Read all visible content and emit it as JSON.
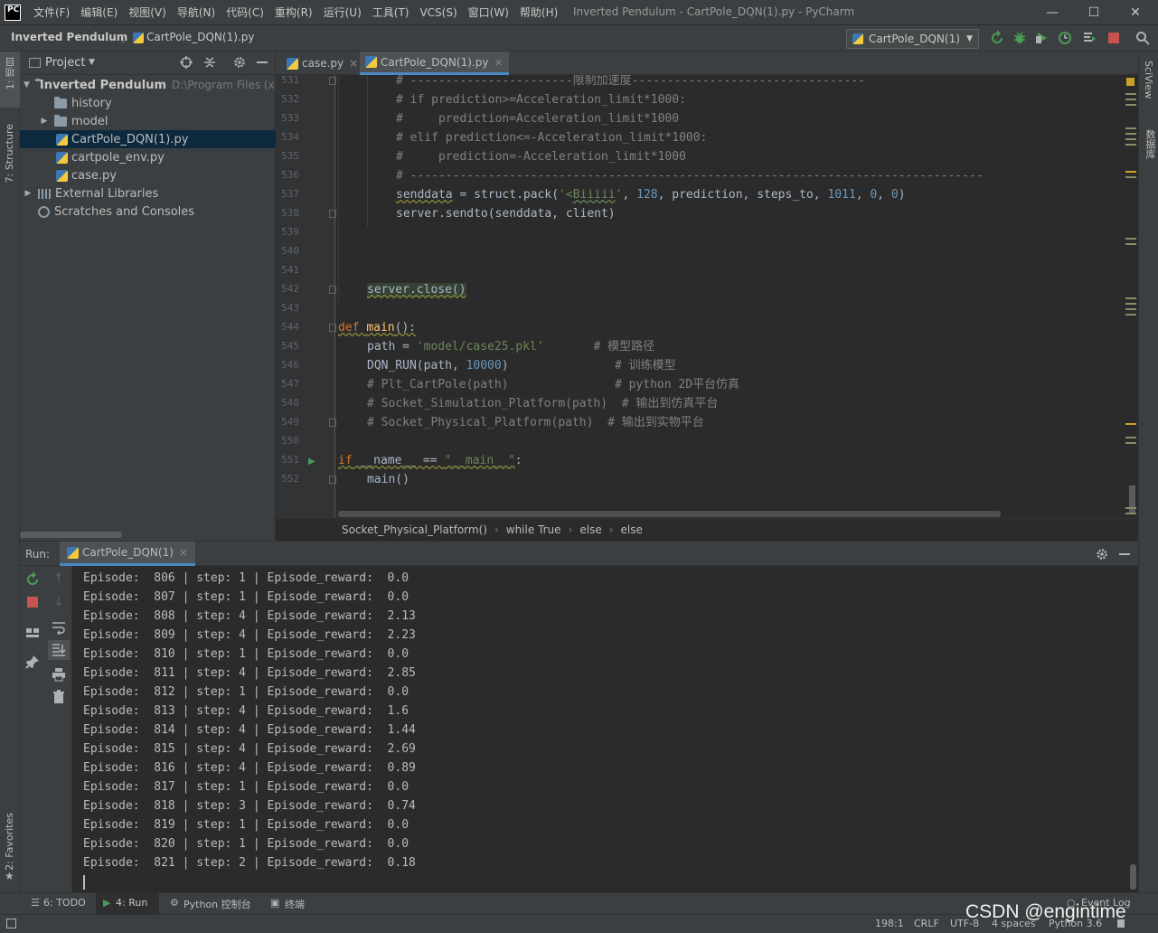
{
  "app": {
    "logo": "PC",
    "title": "Inverted Pendulum - CartPole_DQN(1).py - PyCharm"
  },
  "menu": [
    "文件(F)",
    "编辑(E)",
    "视图(V)",
    "导航(N)",
    "代码(C)",
    "重构(R)",
    "运行(U)",
    "工具(T)",
    "VCS(S)",
    "窗口(W)",
    "帮助(H)"
  ],
  "window_controls": {
    "minimize": "—",
    "maximize": "☐",
    "close": "✕"
  },
  "navbar": {
    "project": "Inverted Pendulum",
    "file": "CartPole_DQN(1).py",
    "run_config": "CartPole_DQN(1)"
  },
  "left_strip": {
    "project_tab": "1: 项目",
    "structure_tab": "7: Structure",
    "favorites_tab": "2: Favorites"
  },
  "right_strip": {
    "sciview_tab": "SciView",
    "database_tab": "数据库"
  },
  "project_panel": {
    "title": "Project",
    "tree": [
      {
        "label": "Inverted Pendulum",
        "hint": "D:\\Program Files (x8",
        "type": "folder",
        "arrow": "▼"
      },
      {
        "label": "history",
        "type": "folder",
        "arrow": ""
      },
      {
        "label": "model",
        "type": "folder",
        "arrow": "▶"
      },
      {
        "label": "CartPole_DQN(1).py",
        "type": "py",
        "arrow": ""
      },
      {
        "label": "cartpole_env.py",
        "type": "py",
        "arrow": ""
      },
      {
        "label": "case.py",
        "type": "py",
        "arrow": ""
      },
      {
        "label": "External Libraries",
        "type": "lib",
        "arrow": "▶"
      },
      {
        "label": "Scratches and Consoles",
        "type": "scratch",
        "arrow": ""
      }
    ]
  },
  "editor": {
    "tabs": [
      {
        "label": "case.py",
        "close": "×"
      },
      {
        "label": "CartPole_DQN(1).py",
        "close": "×"
      }
    ],
    "line_numbers": [
      "531",
      "532",
      "533",
      "534",
      "535",
      "536",
      "537",
      "538",
      "539",
      "540",
      "541",
      "542",
      "543",
      "544",
      "545",
      "546",
      "547",
      "548",
      "549",
      "550",
      "551",
      "552"
    ],
    "code": {
      "l531": "# -----------------------限制加速度---------------------------------",
      "l532": "# if prediction>=Acceleration_limit*1000:",
      "l533": "#     prediction=Acceleration_limit*1000",
      "l534": "# elif prediction<=-Acceleration_limit*1000:",
      "l535": "#     prediction=-Acceleration_limit*1000",
      "l536": "# ---------------------------------------------------------------------------------",
      "l537": {
        "a": "senddata",
        "b": " = struct.pack(",
        "c": "'<",
        "d": "Biiiii",
        "e": "'",
        "f": ", ",
        "g": "128",
        "h": ", prediction, steps_to, ",
        "i": "1011",
        "j": ", ",
        "k": "0",
        "l": ", ",
        "m": "0",
        "n": ")"
      },
      "l538": "server.sendto(senddata, client)",
      "l542": "server.close()",
      "l544": {
        "kw": "def ",
        "fn": "main",
        "rest": "():"
      },
      "l545": {
        "a": "path = ",
        "s": "'model/case25.pkl'",
        "c": "       # 模型路径"
      },
      "l546": {
        "a": "DQN_RUN(path, ",
        "n": "10000",
        "b": ")",
        "c": "               # 训练模型"
      },
      "l547": {
        "a": "# Plt_CartPole(path)",
        "c": "               # python 2D平台仿真"
      },
      "l548": "# Socket_Simulation_Platform(path)  # 输出到仿真平台",
      "l549": "# Socket_Physical_Platform(path)  # 输出到实物平台",
      "l551": {
        "kw": "if",
        "a": " __name__ == ",
        "s": "\"__main__\"",
        "b": ":"
      },
      "l552": "main()"
    },
    "breadcrumb": [
      "Socket_Physical_Platform()",
      "while True",
      "else",
      "else"
    ]
  },
  "run_panel": {
    "label": "Run:",
    "tab": "CartPole_DQN(1)",
    "close": "×",
    "console": [
      "Episode:  806 | step: 1 | Episode_reward:  0.0",
      "Episode:  807 | step: 1 | Episode_reward:  0.0",
      "Episode:  808 | step: 4 | Episode_reward:  2.13",
      "Episode:  809 | step: 4 | Episode_reward:  2.23",
      "Episode:  810 | step: 1 | Episode_reward:  0.0",
      "Episode:  811 | step: 4 | Episode_reward:  2.85",
      "Episode:  812 | step: 1 | Episode_reward:  0.0",
      "Episode:  813 | step: 4 | Episode_reward:  1.6",
      "Episode:  814 | step: 4 | Episode_reward:  1.44",
      "Episode:  815 | step: 4 | Episode_reward:  2.69",
      "Episode:  816 | step: 4 | Episode_reward:  0.89",
      "Episode:  817 | step: 1 | Episode_reward:  0.0",
      "Episode:  818 | step: 3 | Episode_reward:  0.74",
      "Episode:  819 | step: 1 | Episode_reward:  0.0",
      "Episode:  820 | step: 1 | Episode_reward:  0.0",
      "Episode:  821 | step: 2 | Episode_reward:  0.18"
    ]
  },
  "bottom_tools": {
    "todo": "6: TODO",
    "run": "4: Run",
    "python_console": "Python 控制台",
    "terminal": "终端",
    "event_log": "Event Log"
  },
  "status": {
    "position": "198:1",
    "line_sep": "CRLF",
    "encoding": "UTF-8",
    "indent": "4 spaces",
    "interpreter": "Python 3.6"
  },
  "watermark": "CSDN @engintime",
  "colors": {
    "accent": "#4a88c7",
    "selection": "#0d293e",
    "run_green": "#499c54",
    "stop_red": "#c75450"
  }
}
